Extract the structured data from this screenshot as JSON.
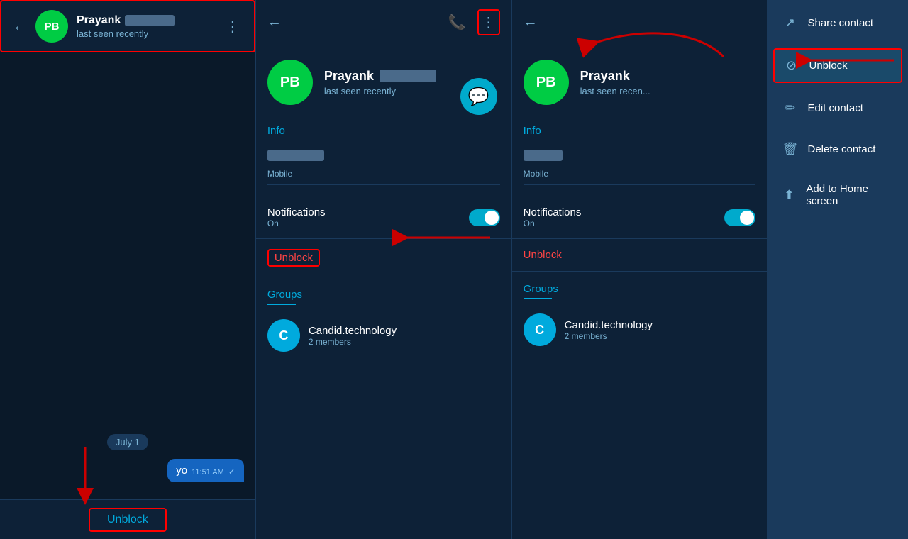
{
  "panel1": {
    "header": {
      "back_label": "←",
      "name": "Prayank",
      "status": "last seen recently",
      "menu_icon": "⋮"
    },
    "chat": {
      "date_badge": "July 1",
      "message_text": "yo",
      "message_time": "11:51 AM",
      "check": "✓"
    },
    "bottom_bar": {
      "unblock_label": "Unblock"
    }
  },
  "panel2": {
    "header": {
      "back_label": "←",
      "phone_icon": "📞",
      "menu_icon": "⋮"
    },
    "profile": {
      "avatar_initials": "PB",
      "name": "Prayank",
      "status": "last seen recently"
    },
    "info_label": "Info",
    "mobile_label": "Mobile",
    "notifications": {
      "label": "Notifications",
      "sub": "On"
    },
    "unblock_label": "Unblock",
    "groups": {
      "label": "Groups",
      "items": [
        {
          "avatar": "C",
          "name": "Candid.technology",
          "members": "2 members"
        }
      ]
    }
  },
  "panel3": {
    "header": {
      "back_label": "←"
    },
    "profile": {
      "avatar_initials": "PB",
      "name": "Prayank",
      "status": "last seen recen..."
    },
    "info_label": "Info",
    "mobile_label": "Mobile",
    "notifications": {
      "label": "Notifications",
      "sub": "On"
    },
    "unblock_label": "Unblock",
    "groups": {
      "label": "Groups",
      "items": [
        {
          "avatar": "C",
          "name": "Candid.technology",
          "members": "2 members"
        }
      ]
    }
  },
  "dropdown": {
    "items": [
      {
        "icon": "↗",
        "label": "Share contact",
        "icon_name": "share-icon"
      },
      {
        "icon": "⊘",
        "label": "Unblock",
        "icon_name": "unblock-icon",
        "highlighted": true
      },
      {
        "icon": "✏",
        "label": "Edit contact",
        "icon_name": "edit-icon"
      },
      {
        "icon": "🗑",
        "label": "Delete contact",
        "icon_name": "delete-icon"
      },
      {
        "icon": "⬆",
        "label": "Add to Home screen",
        "icon_name": "home-screen-icon"
      }
    ]
  },
  "annotations": {
    "red_arrow_color": "#cc0000"
  }
}
